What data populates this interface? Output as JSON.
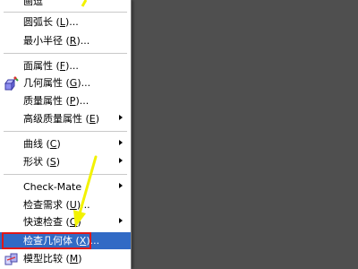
{
  "menu": {
    "items": [
      {
        "key": "item_0",
        "before": "画逗",
        "hotkey": "",
        "after": "",
        "submenu": false
      },
      {
        "key": "item_1",
        "before": "圆弧长 (",
        "hotkey": "L",
        "after": ")...",
        "submenu": false
      },
      {
        "key": "item_2",
        "before": "最小半径 (",
        "hotkey": "R",
        "after": ")...",
        "submenu": false
      },
      {
        "key": "item_3",
        "before": "面属性 (",
        "hotkey": "F",
        "after": ")...",
        "submenu": false
      },
      {
        "key": "item_4",
        "before": "几何属性 (",
        "hotkey": "G",
        "after": ")...",
        "submenu": false
      },
      {
        "key": "item_5",
        "before": "质量属性 (",
        "hotkey": "P",
        "after": ")...",
        "submenu": false
      },
      {
        "key": "item_6",
        "before": "高级质量属性 (",
        "hotkey": "E",
        "after": ")",
        "submenu": true
      },
      {
        "key": "item_7",
        "before": "曲线 (",
        "hotkey": "C",
        "after": ")",
        "submenu": true
      },
      {
        "key": "item_8",
        "before": "形状 (",
        "hotkey": "S",
        "after": ")",
        "submenu": true
      },
      {
        "key": "item_9",
        "before": "Check-Mate",
        "hotkey": "",
        "after": "",
        "submenu": true
      },
      {
        "key": "item_10",
        "before": "检查需求 (",
        "hotkey": "U",
        "after": ")...",
        "submenu": false
      },
      {
        "key": "item_11",
        "before": "快速检查 (",
        "hotkey": "Q",
        "after": ")",
        "submenu": true
      },
      {
        "key": "item_12",
        "before": "检查几何体 (",
        "hotkey": "X",
        "after": ")...",
        "submenu": false
      },
      {
        "key": "item_13",
        "before": "模型比较 (",
        "hotkey": "M",
        "after": ")",
        "submenu": false
      }
    ]
  },
  "colors": {
    "highlight": "#316ac5",
    "annotation_box": "#e01818",
    "annotation_arrow": "#f2f200",
    "background": "#4f4f4f"
  },
  "icons": {
    "geometry_properties": "geometry-properties-icon",
    "model_compare": "model-compare-icon",
    "annotation": "yellow-arrow-annotation"
  }
}
